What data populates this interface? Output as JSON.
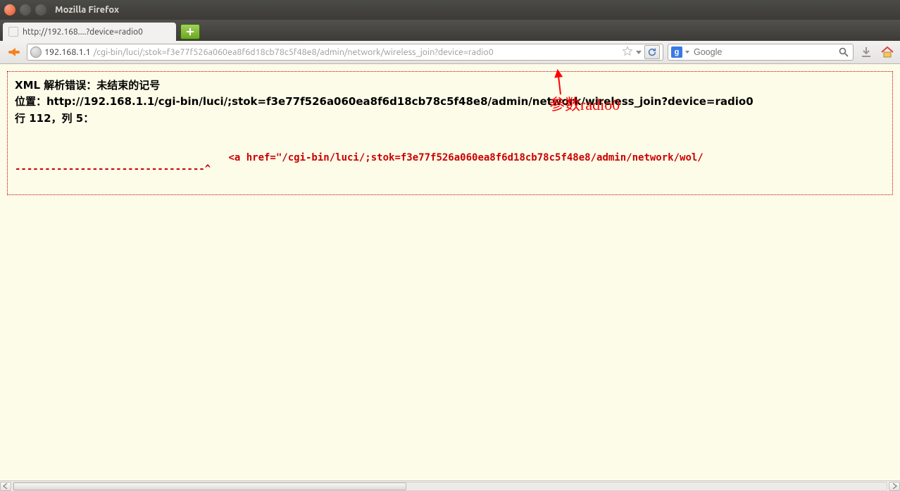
{
  "window": {
    "title": "Mozilla Firefox"
  },
  "tab": {
    "title": "http://192.168....?device=radio0"
  },
  "urlbar": {
    "host": "192.168.1.1",
    "path": "/cgi-bin/luci/;stok=f3e77f526a060ea8f6d18cb78c5f48e8/admin/network/wireless_join?device=radio0"
  },
  "searchbar": {
    "placeholder": "Google",
    "engine_label": "g"
  },
  "error": {
    "line1": "XML 解析错误：未结束的记号",
    "line2": "位置：http://192.168.1.1/cgi-bin/luci/;stok=f3e77f526a060ea8f6d18cb78c5f48e8/admin/network/wireless_join?device=radio0",
    "line3": "行 112，列 5：",
    "code": "                                    <a href=\"/cgi-bin/luci/;stok=f3e77f526a060ea8f6d18cb78c5f48e8/admin/network/wol/",
    "pointer": "--------------------------------^"
  },
  "annotation": {
    "text": "参数radio0"
  }
}
